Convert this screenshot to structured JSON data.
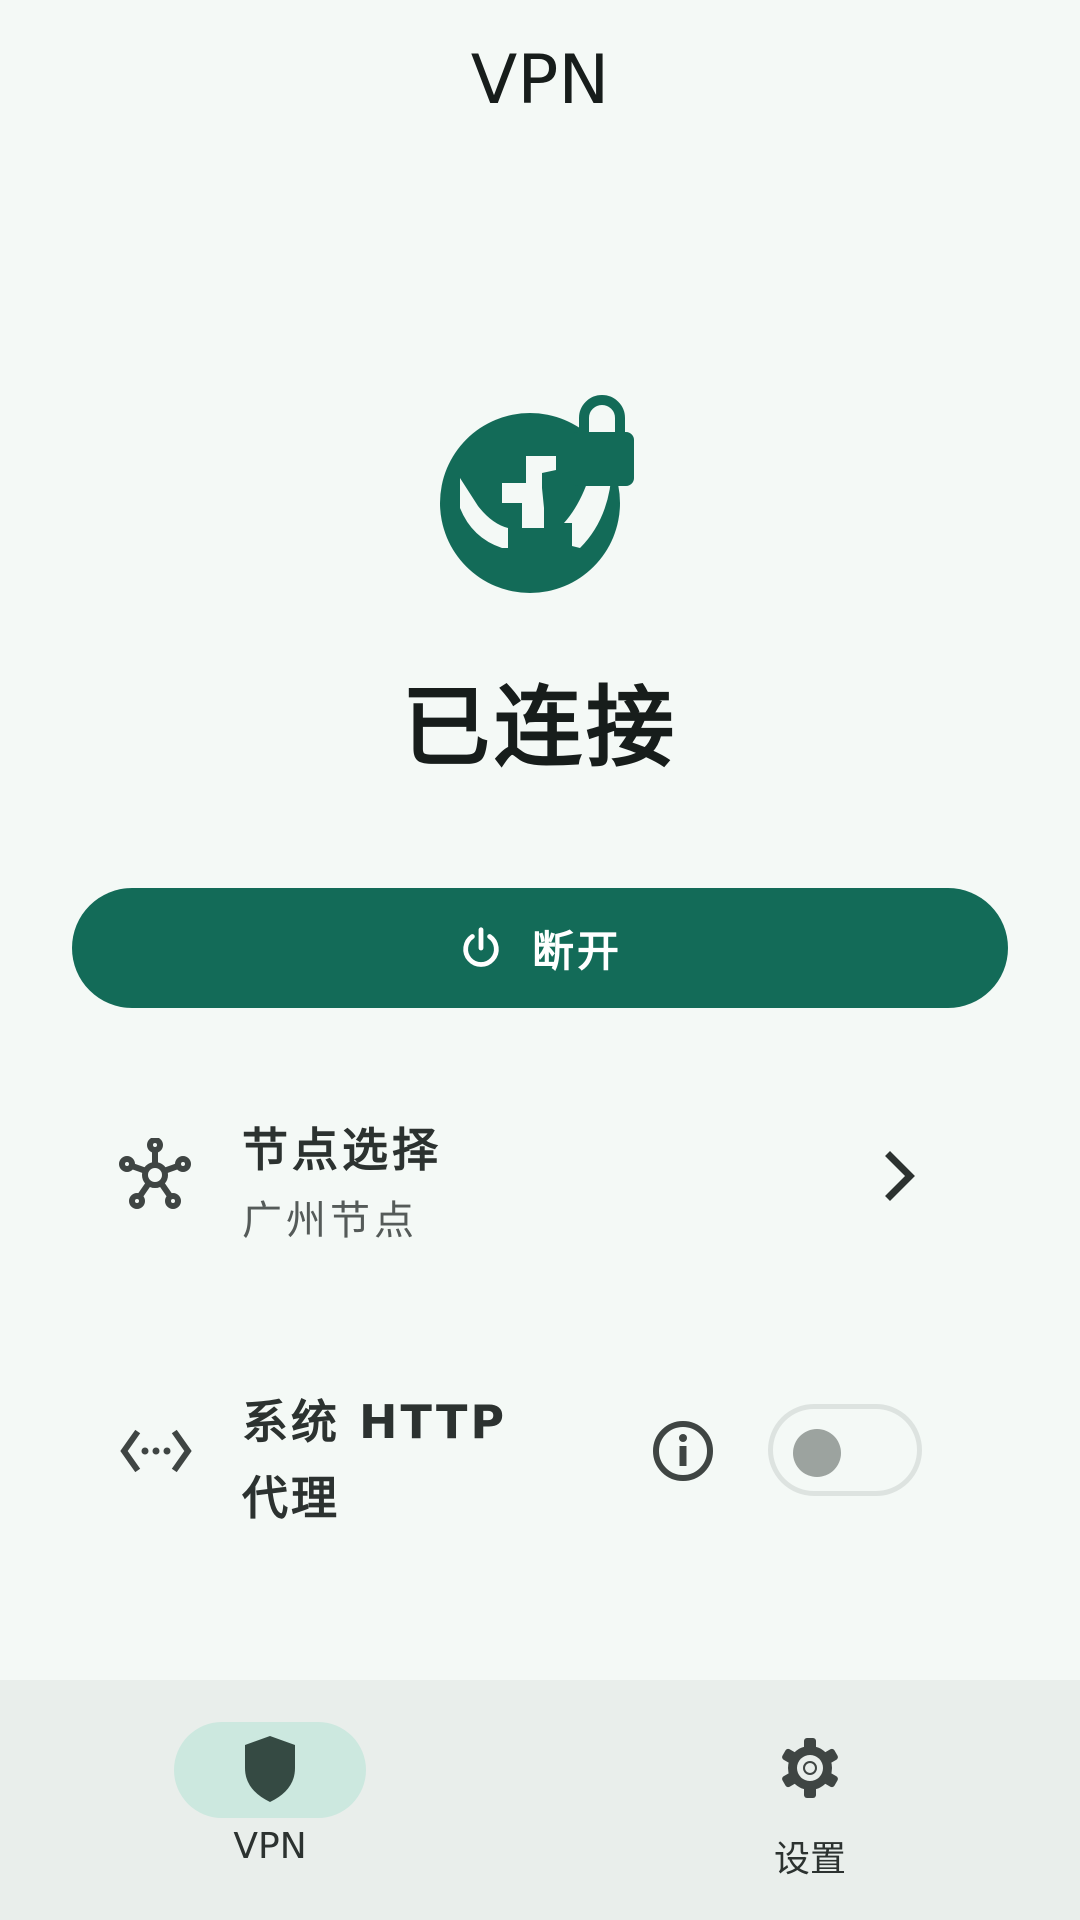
{
  "app": {
    "title": "VPN"
  },
  "status": {
    "text": "已连接"
  },
  "connect_button": {
    "label": "断开"
  },
  "node_select": {
    "title": "节点选择",
    "value": "广州节点"
  },
  "http_proxy": {
    "label": "系统 HTTP 代理",
    "enabled": false
  },
  "bottom_nav": {
    "items": [
      {
        "label": "VPN",
        "icon": "shield-icon",
        "selected": true
      },
      {
        "label": "设置",
        "icon": "gear-icon",
        "selected": false
      }
    ]
  },
  "colors": {
    "primary": "#136B58",
    "background": "#F4F9F6",
    "nav_background": "#E9EEEB",
    "nav_indicator": "#CCE8DF"
  }
}
